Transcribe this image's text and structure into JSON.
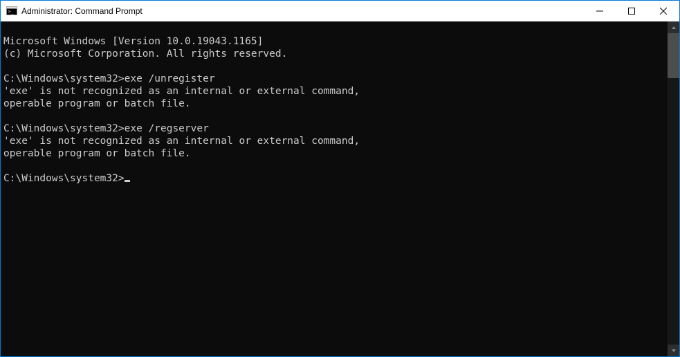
{
  "title": "Administrator: Command Prompt",
  "console": {
    "ver1": "Microsoft Windows [Version 10.0.19043.1165]",
    "ver2": "(c) Microsoft Corporation. All rights reserved.",
    "blank": "",
    "p1_prompt": "C:\\Windows\\system32>",
    "p1_cmd": "exe /unregister",
    "err1a": "'exe' is not recognized as an internal or external command,",
    "err1b": "operable program or batch file.",
    "p2_prompt": "C:\\Windows\\system32>",
    "p2_cmd": "exe /regserver",
    "err2a": "'exe' is not recognized as an internal or external command,",
    "err2b": "operable program or batch file.",
    "p3_prompt": "C:\\Windows\\system32>"
  }
}
